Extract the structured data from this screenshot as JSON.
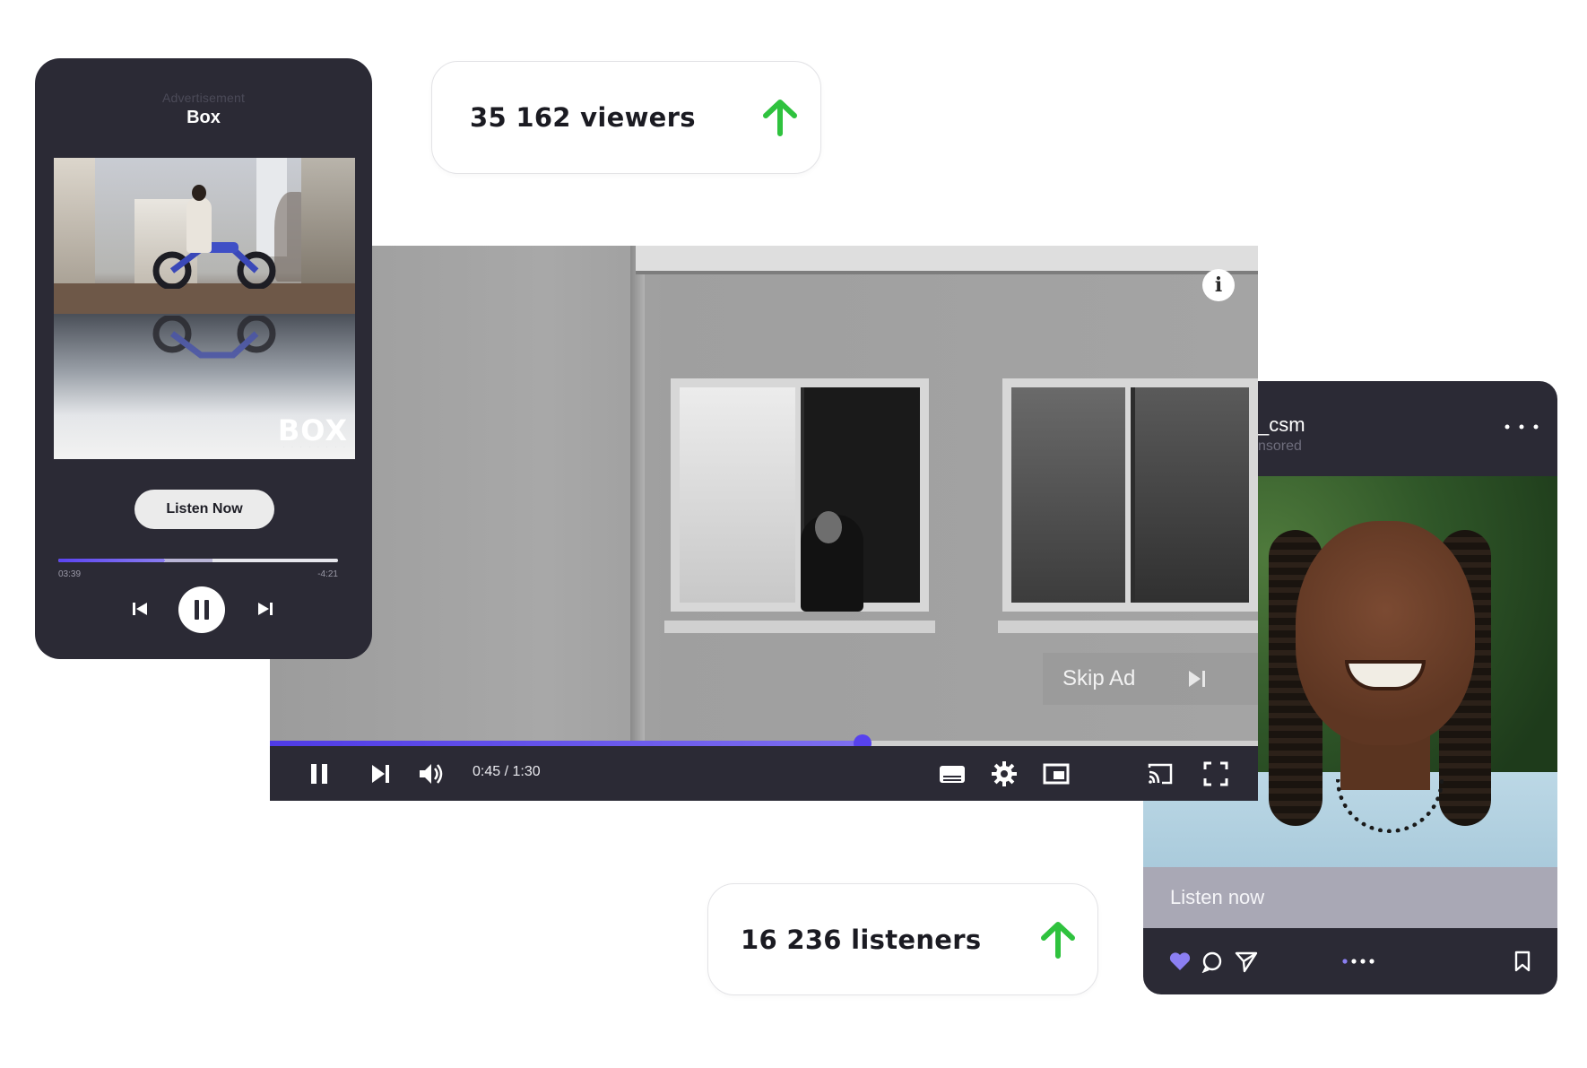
{
  "music_player": {
    "ad_label": "Advertisement",
    "title": "Box",
    "album_logo_text": "BOX",
    "listen_button": "Listen Now",
    "elapsed_time": "03:39",
    "remaining_time": "-4:21",
    "progress_played": 0.38,
    "progress_buffered": 0.55
  },
  "stats": {
    "viewers": "35 162 viewers",
    "listeners": "16 236 listeners",
    "arrow_color": "#2fc23e"
  },
  "video_player": {
    "skip_ad_label": "Skip Ad",
    "time_display": "0:45 / 1:30",
    "progress": 0.6,
    "accent_color": "#5742ee",
    "controls": [
      "pause-icon",
      "next-icon",
      "volume-icon",
      "subtitles-icon",
      "settings-icon",
      "miniplayer-icon",
      "cast-icon",
      "fullscreen-icon"
    ]
  },
  "instagram_post": {
    "handle": "_csm",
    "subtitle": "nsored",
    "listen_label": "Listen now",
    "actions": [
      "heart-icon",
      "comment-icon",
      "share-icon",
      "carousel-dots-icon",
      "bookmark-icon"
    ]
  }
}
